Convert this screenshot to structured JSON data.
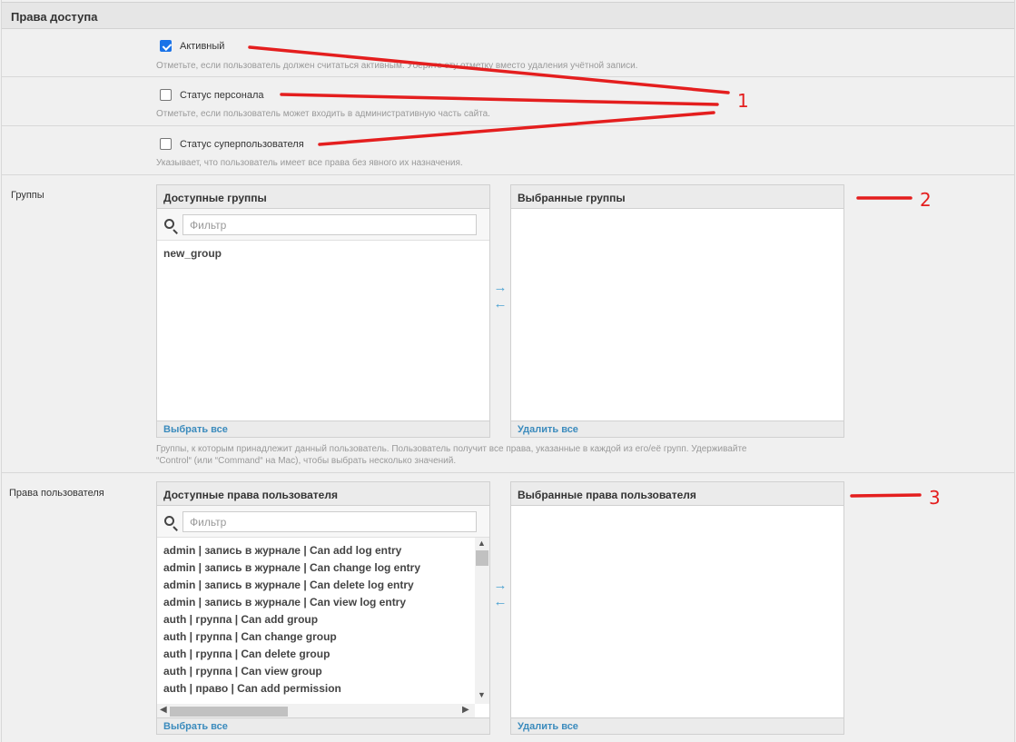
{
  "fieldset": {
    "title": "Права доступа"
  },
  "active": {
    "label": "Активный",
    "checked": true,
    "help": "Отметьте, если пользователь должен считаться активным. Уберите эту отметку вместо удаления учётной записи."
  },
  "staff": {
    "label": "Статус персонала",
    "checked": false,
    "help": "Отметьте, если пользователь может входить в административную часть сайта."
  },
  "superuser": {
    "label": "Статус суперпользователя",
    "checked": false,
    "help": "Указывает, что пользователь имеет все права без явного их назначения."
  },
  "groups": {
    "label": "Группы",
    "available_title": "Доступные группы",
    "chosen_title": "Выбранные группы",
    "filter_placeholder": "Фильтр",
    "available_items": [
      "new_group"
    ],
    "choose_all": "Выбрать все",
    "remove_all": "Удалить все",
    "arrow_right": "→",
    "arrow_left": "←",
    "help_line1": "Группы, к которым принадлежит данный пользователь. Пользователь получит все права, указанные в каждой из его/её групп. Удерживайте",
    "help_line2": "“Control“ (или “Command“ на Mac), чтобы выбрать несколько значений."
  },
  "permissions": {
    "label": "Права пользователя",
    "available_title": "Доступные права пользователя",
    "chosen_title": "Выбранные права пользователя",
    "filter_placeholder": "Фильтр",
    "available_items": [
      "admin | запись в журнале | Can add log entry",
      "admin | запись в журнале | Can change log entry",
      "admin | запись в журнале | Can delete log entry",
      "admin | запись в журнале | Can view log entry",
      "auth | группа | Can add group",
      "auth | группа | Can change group",
      "auth | группа | Can delete group",
      "auth | группа | Can view group",
      "auth | право | Can add permission"
    ],
    "choose_all": "Выбрать все",
    "remove_all": "Удалить все",
    "arrow_right": "→",
    "arrow_left": "←"
  },
  "annotations": {
    "n1": "1",
    "n2": "2",
    "n3": "3"
  },
  "colors": {
    "annotation": "#e41e1e",
    "link": "#3b8bbd",
    "checkbox": "#1a73e8"
  }
}
